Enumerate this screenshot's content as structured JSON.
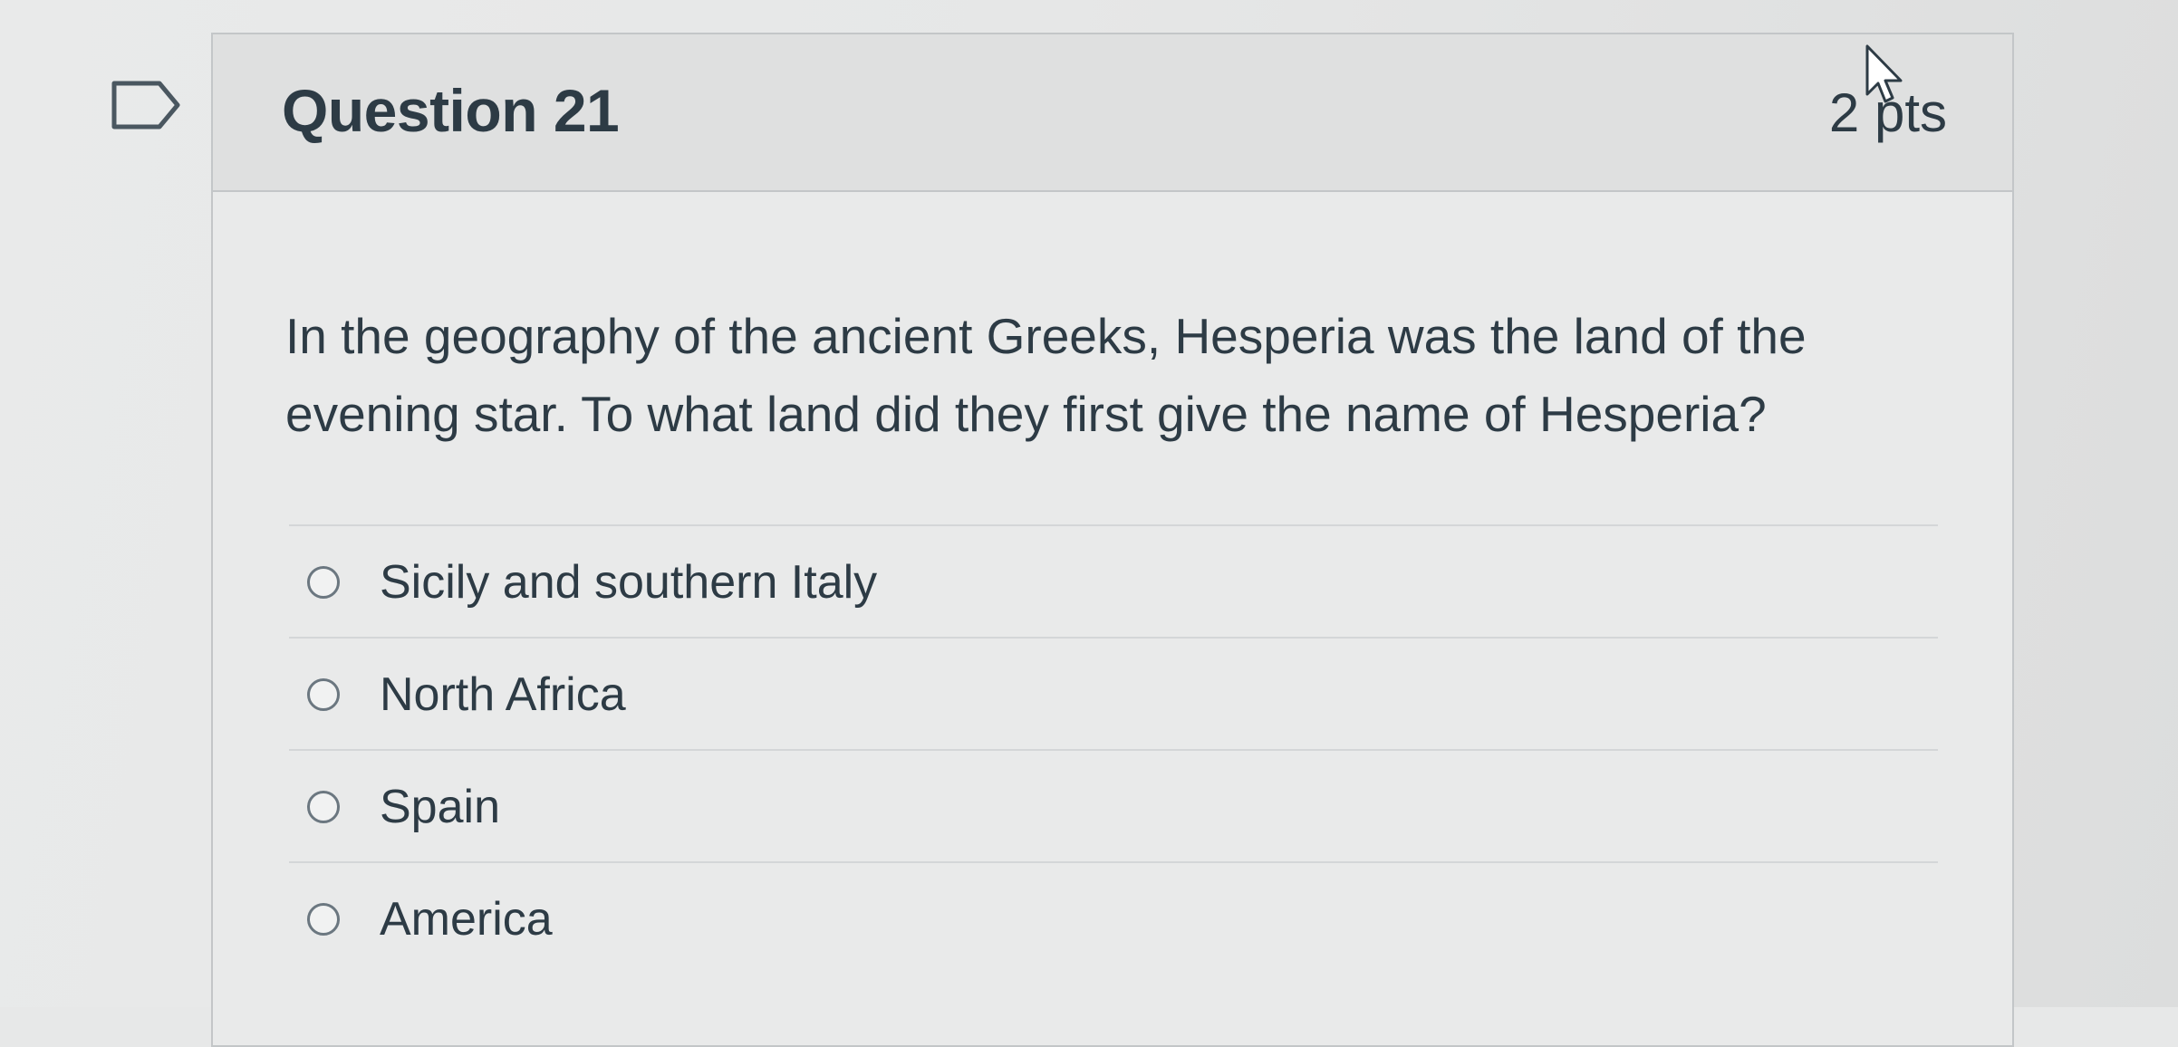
{
  "question": {
    "title": "Question 21",
    "points": "2 pts",
    "text": "In the geography of the ancient Greeks, Hesperia was the land of the evening star.  To what land did they first give the name of Hesperia?"
  },
  "answers": [
    {
      "label": "Sicily and southern Italy",
      "selected": false
    },
    {
      "label": "North Africa",
      "selected": false
    },
    {
      "label": "Spain",
      "selected": false
    },
    {
      "label": "America",
      "selected": false
    }
  ],
  "icons": {
    "flag": "flag-question-icon",
    "cursor": "mouse-pointer-icon"
  },
  "colors": {
    "text": "#2d3b45",
    "border": "#c3c6c8",
    "header_bg": "#dfe0e0"
  }
}
